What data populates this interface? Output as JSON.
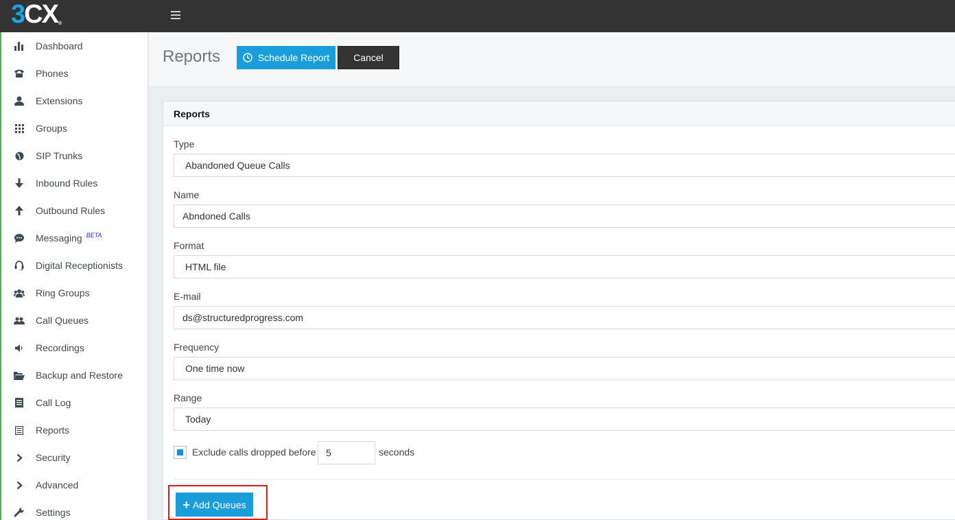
{
  "app": {
    "logo": {
      "part1": "3",
      "part2": "C",
      "part3": "X",
      "mark": "®"
    }
  },
  "sidebar": {
    "items": [
      {
        "label": "Dashboard",
        "icon": "bar-chart-icon"
      },
      {
        "label": "Phones",
        "icon": "phone-icon"
      },
      {
        "label": "Extensions",
        "icon": "user-icon"
      },
      {
        "label": "Groups",
        "icon": "grid-icon"
      },
      {
        "label": "SIP Trunks",
        "icon": "globe-icon"
      },
      {
        "label": "Inbound Rules",
        "icon": "arrow-down-icon"
      },
      {
        "label": "Outbound Rules",
        "icon": "arrow-up-icon"
      },
      {
        "label": "Messaging",
        "icon": "chat-icon",
        "badge": "BETA"
      },
      {
        "label": "Digital Receptionists",
        "icon": "headset-icon"
      },
      {
        "label": "Ring Groups",
        "icon": "users-icon"
      },
      {
        "label": "Call Queues",
        "icon": "user-group-icon"
      },
      {
        "label": "Recordings",
        "icon": "speaker-icon"
      },
      {
        "label": "Backup and Restore",
        "icon": "folder-open-icon"
      },
      {
        "label": "Call Log",
        "icon": "list-icon"
      },
      {
        "label": "Reports",
        "icon": "report-icon"
      },
      {
        "label": "Security",
        "icon": "chevron-right-icon"
      },
      {
        "label": "Advanced",
        "icon": "chevron-right-icon"
      },
      {
        "label": "Settings",
        "icon": "wrench-icon"
      }
    ]
  },
  "header": {
    "title": "Reports",
    "schedule_label": "Schedule Report",
    "cancel_label": "Cancel"
  },
  "panel": {
    "title": "Reports",
    "fields": {
      "type": {
        "label": "Type",
        "value": "Abandoned Queue Calls"
      },
      "name": {
        "label": "Name",
        "value": "Abndoned Calls"
      },
      "format": {
        "label": "Format",
        "value": "HTML file"
      },
      "email": {
        "label": "E-mail",
        "value": "ds@structuredprogress.com"
      },
      "frequency": {
        "label": "Frequency",
        "value": "One time now"
      },
      "range": {
        "label": "Range",
        "value": "Today"
      }
    },
    "exclude": {
      "label": "Exclude calls dropped before",
      "checked": true,
      "value": "5",
      "unit": "seconds"
    },
    "add_queues_label": "Add Queues"
  },
  "colors": {
    "accent": "#1a9ddb",
    "topbar": "#333333",
    "highlight": "#e0191b"
  }
}
